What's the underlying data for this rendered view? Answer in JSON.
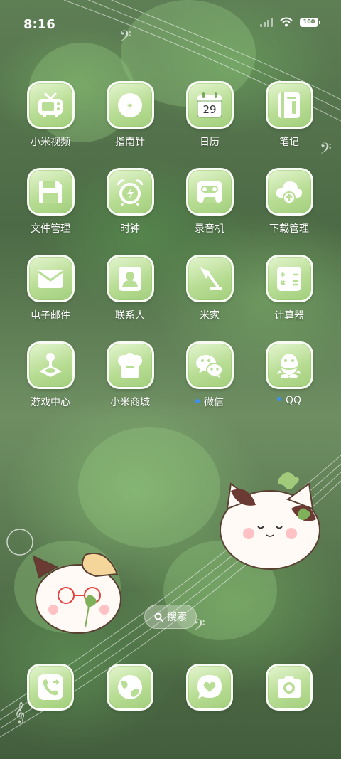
{
  "status_bar": {
    "time": "8:16",
    "battery": "100"
  },
  "apps": [
    {
      "label": "小米视频",
      "icon": "tv-icon",
      "dot": false
    },
    {
      "label": "指南针",
      "icon": "compass-icon",
      "dot": false
    },
    {
      "label": "日历",
      "icon": "calendar-icon",
      "dot": false,
      "date": "29"
    },
    {
      "label": "笔记",
      "icon": "notebook-icon",
      "dot": false
    },
    {
      "label": "文件管理",
      "icon": "floppy-disk-icon",
      "dot": false
    },
    {
      "label": "时钟",
      "icon": "alarm-clock-icon",
      "dot": false
    },
    {
      "label": "录音机",
      "icon": "cassette-icon",
      "dot": false
    },
    {
      "label": "下载管理",
      "icon": "cloud-download-icon",
      "dot": false
    },
    {
      "label": "电子邮件",
      "icon": "envelope-icon",
      "dot": false
    },
    {
      "label": "联系人",
      "icon": "contact-card-icon",
      "dot": false
    },
    {
      "label": "米家",
      "icon": "desk-lamp-icon",
      "dot": false
    },
    {
      "label": "计算器",
      "icon": "calculator-icon",
      "dot": false
    },
    {
      "label": "游戏中心",
      "icon": "joystick-icon",
      "dot": false
    },
    {
      "label": "小米商城",
      "icon": "chef-hat-icon",
      "dot": false
    },
    {
      "label": "微信",
      "icon": "wechat-icon",
      "dot": true
    },
    {
      "label": "QQ",
      "icon": "qq-penguin-icon",
      "dot": true
    }
  ],
  "search": {
    "label": "搜索"
  },
  "dock": [
    {
      "icon": "phone-icon"
    },
    {
      "icon": "globe-browser-icon"
    },
    {
      "icon": "message-heart-icon"
    },
    {
      "icon": "camera-icon"
    }
  ],
  "colors": {
    "icon_bg": "#b8dd94",
    "icon_glyph": "#ffffff",
    "dot": "#3e8ef7"
  }
}
